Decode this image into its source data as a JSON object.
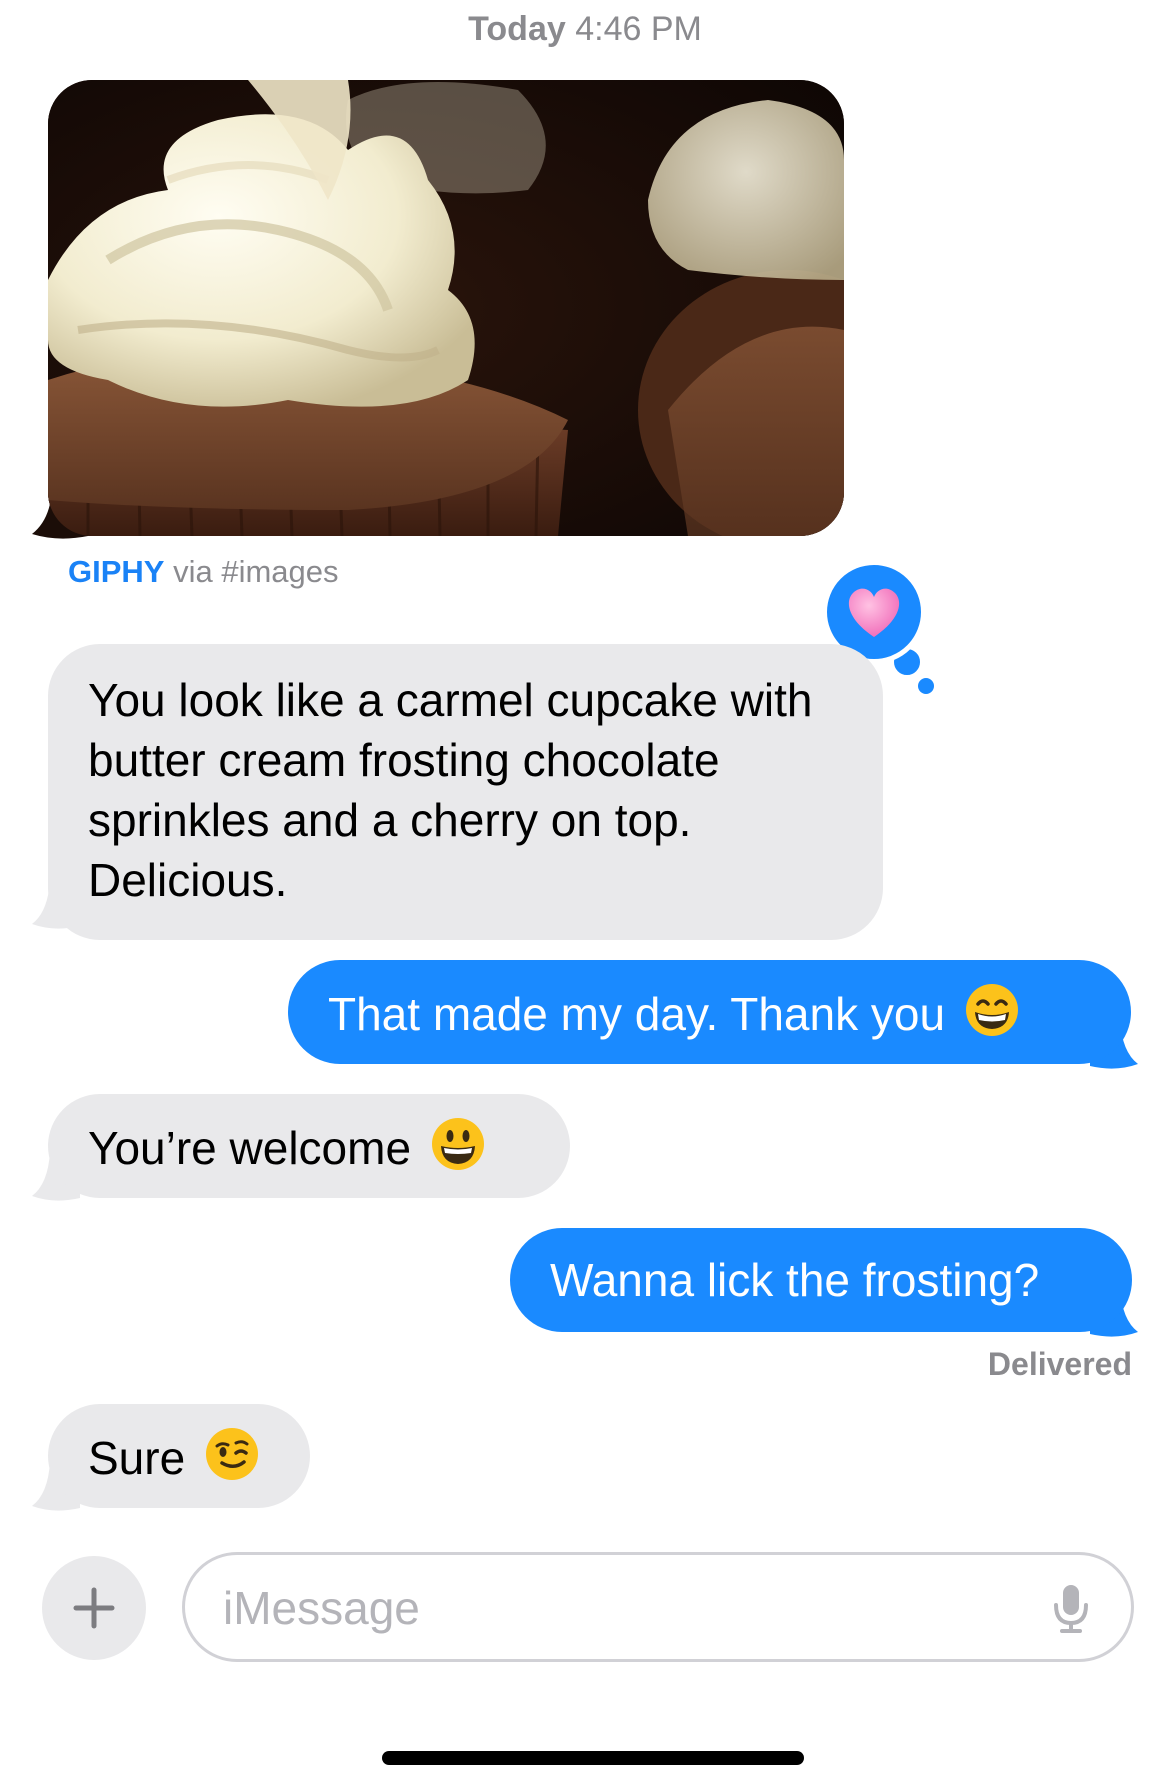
{
  "header": {
    "day": "Today",
    "time": "4:46 PM"
  },
  "gif_message": {
    "source_brand": "GIPHY",
    "source_suffix": "via #images",
    "image_icon": "cupcake-gif-image"
  },
  "tapback": {
    "icon": "heart-icon",
    "color": "#f48fc9"
  },
  "messages": [
    {
      "sender": "incoming",
      "text": "You look like a carmel cupcake with butter cream frosting chocolate sprinkles and a cherry on top. Delicious."
    },
    {
      "sender": "outgoing",
      "text": "That made my day. Thank you",
      "emoji_icon": "grinning-smiling-eyes-emoji-icon"
    },
    {
      "sender": "incoming",
      "text": "You’re welcome",
      "emoji_icon": "grinning-face-emoji-icon"
    },
    {
      "sender": "outgoing",
      "text": "Wanna lick the frosting?"
    },
    {
      "sender": "incoming",
      "text": "Sure",
      "emoji_icon": "winking-face-emoji-icon"
    }
  ],
  "status": {
    "delivered": "Delivered"
  },
  "composer": {
    "placeholder": "iMessage",
    "plus_icon": "plus-icon",
    "mic_icon": "microphone-icon"
  },
  "colors": {
    "outgoing_bubble": "#1a8aff",
    "incoming_bubble": "#e9e9eb",
    "brand_link": "#1a82f6",
    "secondary_text": "#8a8a8e"
  }
}
